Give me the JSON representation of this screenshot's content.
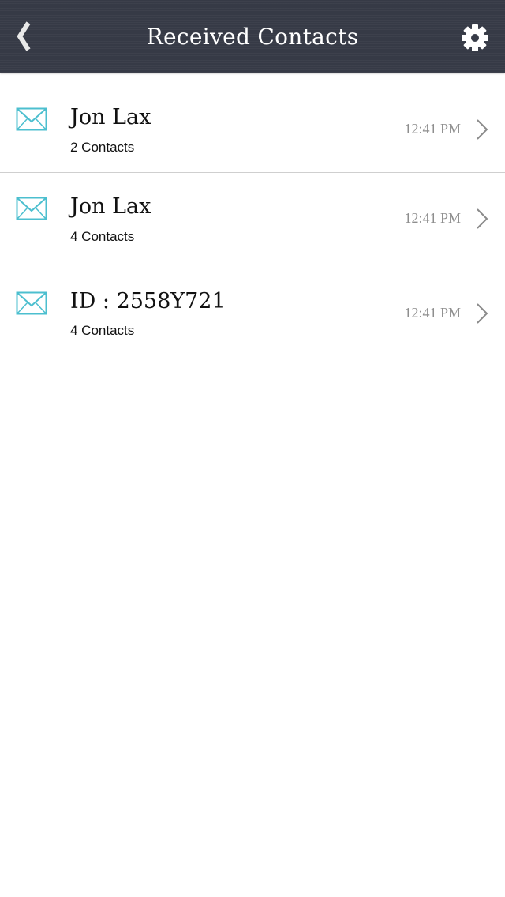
{
  "navbar": {
    "title": "Received Contacts",
    "back_icon": "chevron-left-icon",
    "settings_icon": "gear-icon",
    "background_color": "#383c48"
  },
  "contacts": [
    {
      "name": "Jon Lax",
      "count": "2 Contacts",
      "time": "12:41 PM",
      "icon": "envelope-icon"
    },
    {
      "name": "Jon Lax",
      "count": "4 Contacts",
      "time": "12:41 PM",
      "icon": "envelope-icon"
    },
    {
      "name": "ID : 2558Y721",
      "count": "4 Contacts",
      "time": "12:41 PM",
      "icon": "envelope-icon"
    }
  ],
  "colors": {
    "accent": "#4cbfcf",
    "divider": "#cfcfcf",
    "time_text": "#8e8e8e"
  }
}
